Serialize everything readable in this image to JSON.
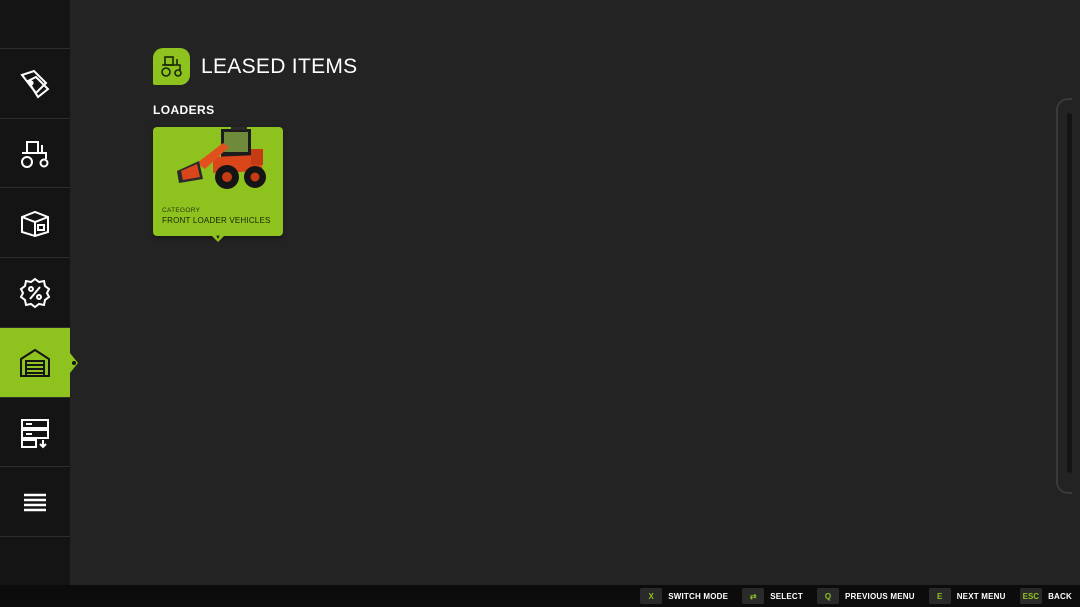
{
  "header": {
    "title": "LEASED ITEMS",
    "icon": "tractor-icon"
  },
  "section": {
    "title": "LOADERS"
  },
  "card": {
    "category_label": "CATEGORY",
    "category_value": "FRONT LOADER VEHICLES",
    "image": "wheel-loader-image"
  },
  "sidebar": {
    "items": [
      {
        "icon": "price-tags-icon"
      },
      {
        "icon": "tractor-icon"
      },
      {
        "icon": "box-icon"
      },
      {
        "icon": "discount-icon"
      },
      {
        "icon": "garage-icon",
        "active": true
      },
      {
        "icon": "storage-icon"
      },
      {
        "icon": "list-icon"
      }
    ]
  },
  "bottom_bar": {
    "hints": [
      {
        "key": "X",
        "label": "SWITCH MODE"
      },
      {
        "key": "⇄",
        "label": "SELECT"
      },
      {
        "key": "Q",
        "label": "PREVIOUS MENU"
      },
      {
        "key": "E",
        "label": "NEXT MENU"
      },
      {
        "key": "ESC",
        "label": "BACK"
      }
    ]
  },
  "colors": {
    "accent": "#8dc21f",
    "background": "#232323",
    "sidebar": "#141414"
  }
}
